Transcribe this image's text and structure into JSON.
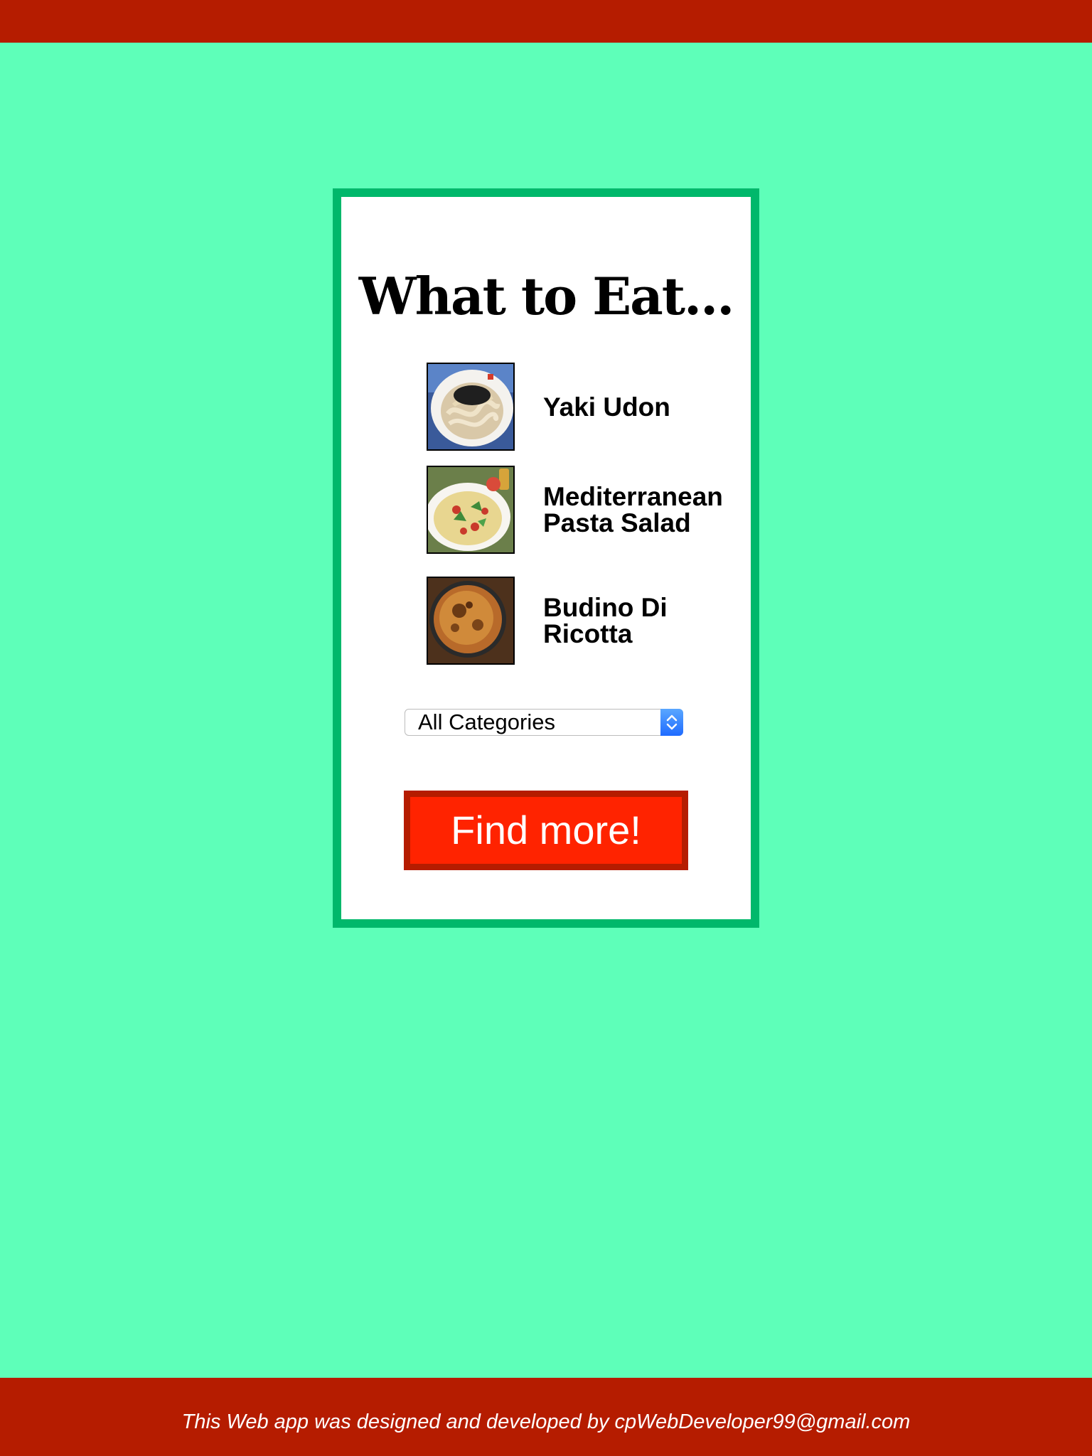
{
  "page": {
    "title": "What to Eat...",
    "colors": {
      "background": "#5effb9",
      "bars": "#b51c00",
      "card_border": "#00b86b",
      "button": "#ff2300"
    }
  },
  "dishes": [
    {
      "name": "Yaki Udon",
      "icon": "noodle-dish-photo"
    },
    {
      "name": "Mediterranean Pasta Salad",
      "icon": "pasta-salad-photo"
    },
    {
      "name": "Budino Di Ricotta",
      "icon": "ricotta-cake-photo"
    }
  ],
  "category_select": {
    "selected": "All Categories"
  },
  "find_button": {
    "label": "Find more!"
  },
  "footer": {
    "text": "This Web app was designed and developed by cpWebDeveloper99@gmail.com"
  }
}
